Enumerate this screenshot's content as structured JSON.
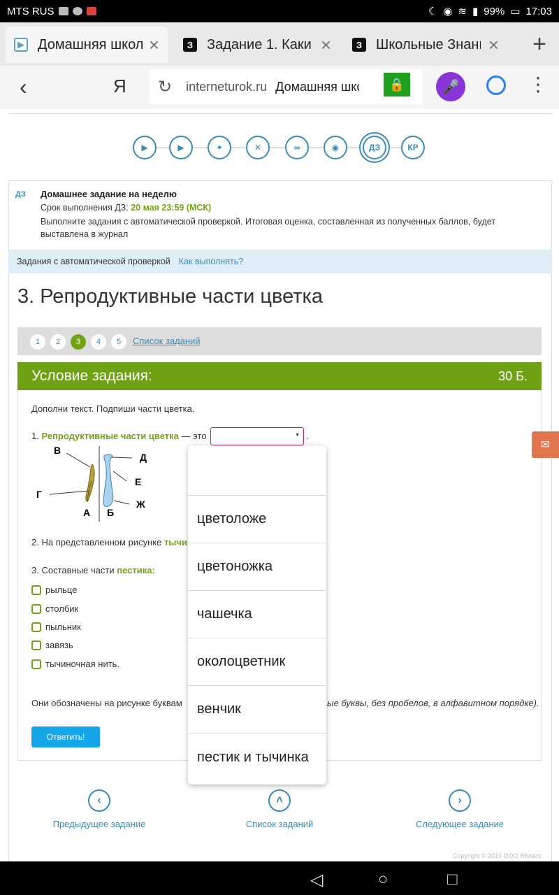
{
  "status_bar": {
    "carrier": "MTS RUS",
    "battery": "99%",
    "time": "17:03"
  },
  "tabs": [
    {
      "title": "Домашняя школа",
      "favicon": "play-icon"
    },
    {
      "title": "Задание 1. Какие",
      "favicon": "З"
    },
    {
      "title": "Школьные Знания",
      "favicon": "З"
    }
  ],
  "address_bar": {
    "yandex": "Я",
    "domain": "interneturok.ru",
    "page_title": "Домашняя школа"
  },
  "steps": [
    "",
    "",
    "",
    "",
    "",
    "",
    "ДЗ",
    "КР"
  ],
  "homework": {
    "tag": "ДЗ",
    "title": "Домашнее задание на неделю",
    "deadline_label": "Срок выполнения ДЗ:",
    "deadline_value": "20 мая 23:59 (МСК)",
    "note": "Выполните задания с автоматической проверкой. Итоговая оценка, составленная из полученных баллов, будет выставлена в журнал"
  },
  "auto_band": {
    "label": "Задания с автоматической проверкой",
    "how": "Как выполнять?"
  },
  "task": {
    "title": "3. Репродуктивные части цветка",
    "pages": [
      "1",
      "2",
      "3",
      "4",
      "5"
    ],
    "active_page": "3",
    "list_link": "Список заданий",
    "condition_label": "Условие задания:",
    "points": "30 Б."
  },
  "question": {
    "intro": "Дополни текст. Подпиши части цветка.",
    "q1_prefix": "1. ",
    "q1_term": "Репродуктивные части цветка",
    "q1_suffix": " — это",
    "q1_end": ".",
    "q2_prefix": "2. На представленном рисунке ",
    "q2_term": "тычи",
    "q3_prefix": "3. Составные части ",
    "q3_term": "пестика:",
    "options": [
      "рыльце",
      "столбик",
      "пыльник",
      "завязь",
      "тычиночная нить."
    ],
    "letters_prefix": "Они обозначены на рисунке буквам",
    "letters_tail": "ые буквы, без пробелов, в алфавитном порядке).",
    "answer_button": "Ответить!"
  },
  "figure_labels": {
    "v": "В",
    "g": "Г",
    "a": "А",
    "b": "Б",
    "d": "Д",
    "e": "Е",
    "zh": "Ж"
  },
  "dropdown": [
    "",
    "цветоложе",
    "цветоножка",
    "чашечка",
    "околоцветник",
    "венчик",
    "пестик и тычинка"
  ],
  "nav": {
    "prev": "Предыдущее задание",
    "list": "Список заданий",
    "next": "Следующее задание"
  },
  "copyright": "Copyright © 2019 ООО ЯКласс"
}
